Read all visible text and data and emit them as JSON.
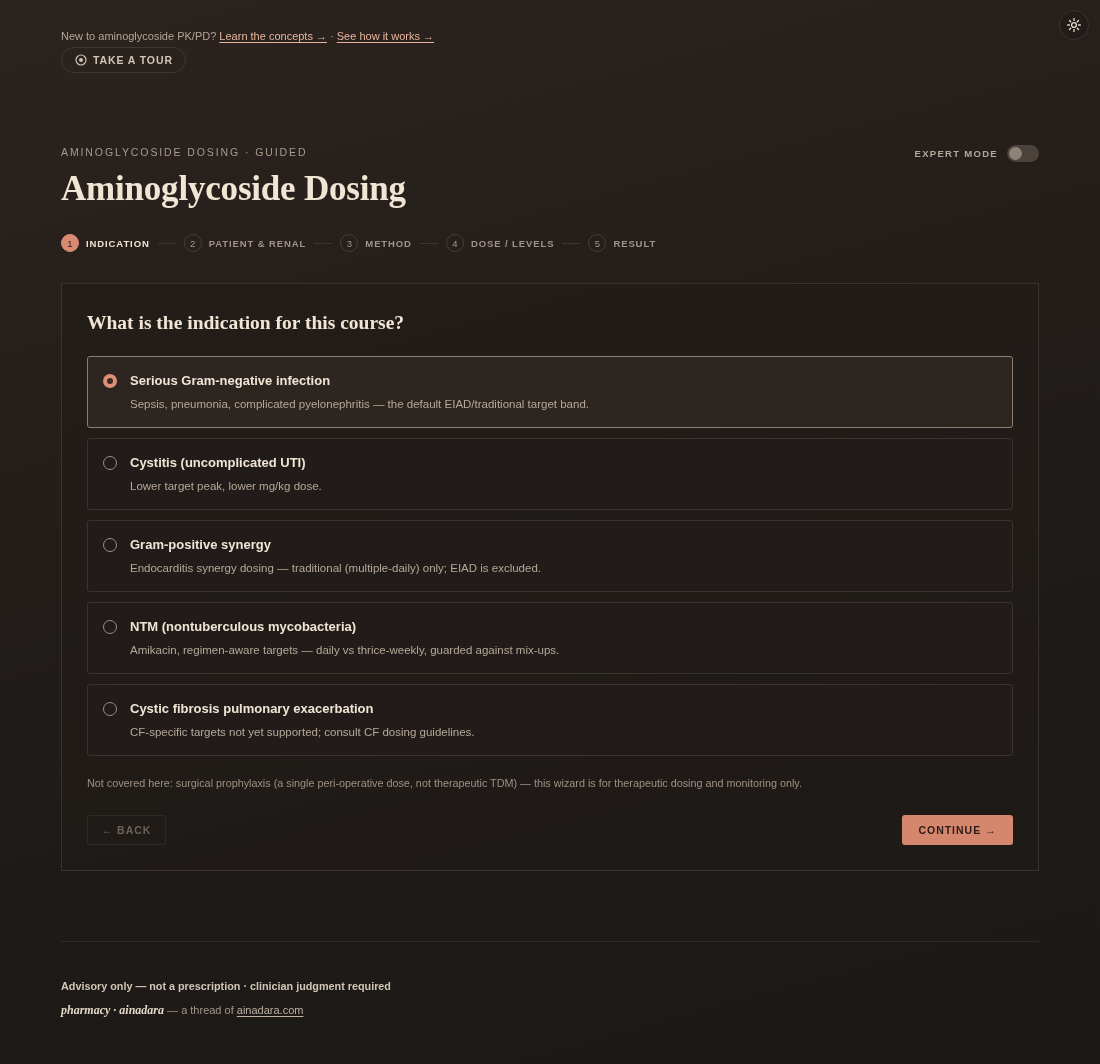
{
  "intro": {
    "text": "New to aminoglycoside PK/PD?",
    "links": [
      {
        "label": "Learn the concepts →"
      },
      {
        "label": "See how it works →"
      }
    ],
    "separator": "·"
  },
  "tour_button": {
    "label": "TAKE A TOUR"
  },
  "header": {
    "eyebrow": "AMINOGLYCOSIDE DOSING · GUIDED",
    "title": "Aminoglycoside Dosing",
    "expert_mode": {
      "label": "EXPERT MODE",
      "on": false
    }
  },
  "steps": [
    {
      "number": "1",
      "label": "INDICATION",
      "selected": true
    },
    {
      "number": "2",
      "label": "PATIENT & RENAL",
      "selected": false
    },
    {
      "number": "3",
      "label": "METHOD",
      "selected": false
    },
    {
      "number": "4",
      "label": "DOSE / LEVELS",
      "selected": false
    },
    {
      "number": "5",
      "label": "RESULT",
      "selected": false
    }
  ],
  "question": {
    "title": "What is the indication for this course?",
    "options": [
      {
        "title": "Serious Gram-negative infection",
        "description": "Sepsis, pneumonia, complicated pyelonephritis — the default EIAD/traditional target band.",
        "selected": true
      },
      {
        "title": "Cystitis (uncomplicated UTI)",
        "description": "Lower target peak, lower mg/kg dose.",
        "selected": false
      },
      {
        "title": "Gram-positive synergy",
        "description": "Endocarditis synergy dosing — traditional (multiple-daily) only; EIAD is excluded.",
        "selected": false
      },
      {
        "title": "NTM (nontuberculous mycobacteria)",
        "description": "Amikacin, regimen-aware targets — daily vs thrice-weekly, guarded against mix-ups.",
        "selected": false
      },
      {
        "title": "Cystic fibrosis pulmonary exacerbation",
        "description": "CF-specific targets not yet supported; consult CF dosing guidelines.",
        "selected": false
      }
    ],
    "note": "Not covered here: surgical prophylaxis (a single peri-operative dose, not therapeutic TDM) — this wizard is for therapeutic dosing and monitoring only.",
    "back_button": {
      "label": "← BACK",
      "disabled": true
    },
    "continue_button": {
      "label": "CONTINUE →"
    }
  },
  "footer": {
    "disclaimer": "Advisory only — not a prescription · clinician judgment required",
    "credit": {
      "brand": "pharmacy · ainadara",
      "text": "— a thread of",
      "link": "ainadara.com"
    }
  }
}
